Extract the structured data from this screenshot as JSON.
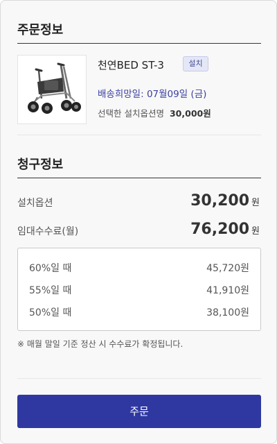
{
  "order_section": {
    "title": "주문정보",
    "product": {
      "name": "천연BED ST-3",
      "badge": "설치",
      "delivery": "배송희망일: 07월09일 (금)",
      "option_label": "선택한 설치옵션명",
      "option_price": "30,000원"
    }
  },
  "billing_section": {
    "title": "청구정보",
    "install_option": {
      "label": "설치옵션",
      "value": "30,200",
      "unit": "원"
    },
    "rental_fee": {
      "label": "임대수수료(월)",
      "value": "76,200",
      "unit": "원"
    },
    "rates": [
      {
        "label": "60%일 때",
        "value": "45,720원"
      },
      {
        "label": "55%일 때",
        "value": "41,910원"
      },
      {
        "label": "50%일 때",
        "value": "38,100원"
      }
    ],
    "note": "※ 매월 말일 기준 정산 시 수수료가 확정됩니다."
  },
  "order_button": {
    "label": "주문"
  },
  "colors": {
    "accent": "#2f38a0",
    "badge_bg": "#e4e7f6"
  },
  "icons": {
    "product_image": "rollator-walker-image"
  }
}
